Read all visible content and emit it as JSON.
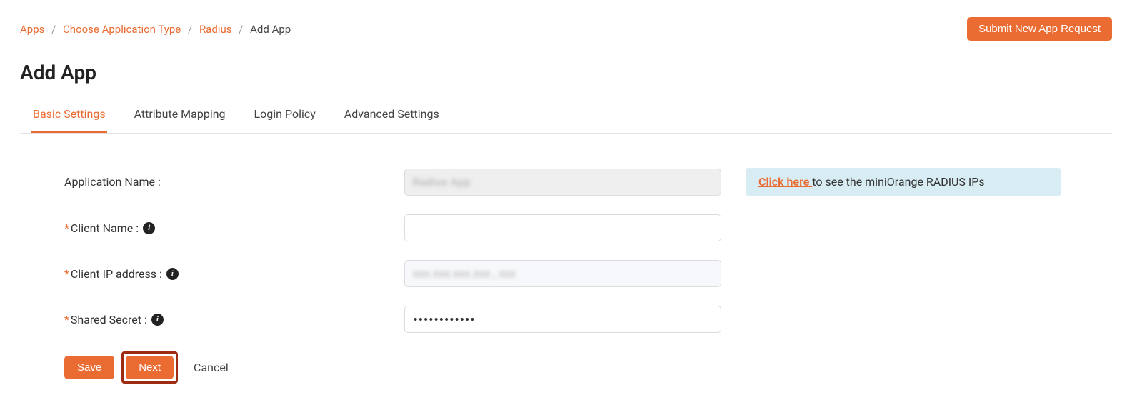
{
  "breadcrumb": {
    "items": [
      "Apps",
      "Choose Application Type",
      "Radius",
      "Add App"
    ]
  },
  "header": {
    "submit_button": "Submit New App Request",
    "page_title": "Add App"
  },
  "tabs": {
    "items": [
      {
        "label": "Basic Settings",
        "active": true
      },
      {
        "label": "Attribute Mapping",
        "active": false
      },
      {
        "label": "Login Policy",
        "active": false
      },
      {
        "label": "Advanced Settings",
        "active": false
      }
    ]
  },
  "form": {
    "app_name_label": "Application Name :",
    "app_name_value": "Radius   App",
    "client_name_label": "Client Name :",
    "client_name_value": "",
    "client_ip_label": "Client IP address :",
    "client_ip_value": "xxx.xxx.xxx.xxx , xxx",
    "shared_secret_label": "Shared Secret :",
    "shared_secret_value": "••••••••••••"
  },
  "note": {
    "link_text": "Click here ",
    "rest_text": "to see the miniOrange RADIUS IPs"
  },
  "actions": {
    "save": "Save",
    "next": "Next",
    "cancel": "Cancel"
  }
}
